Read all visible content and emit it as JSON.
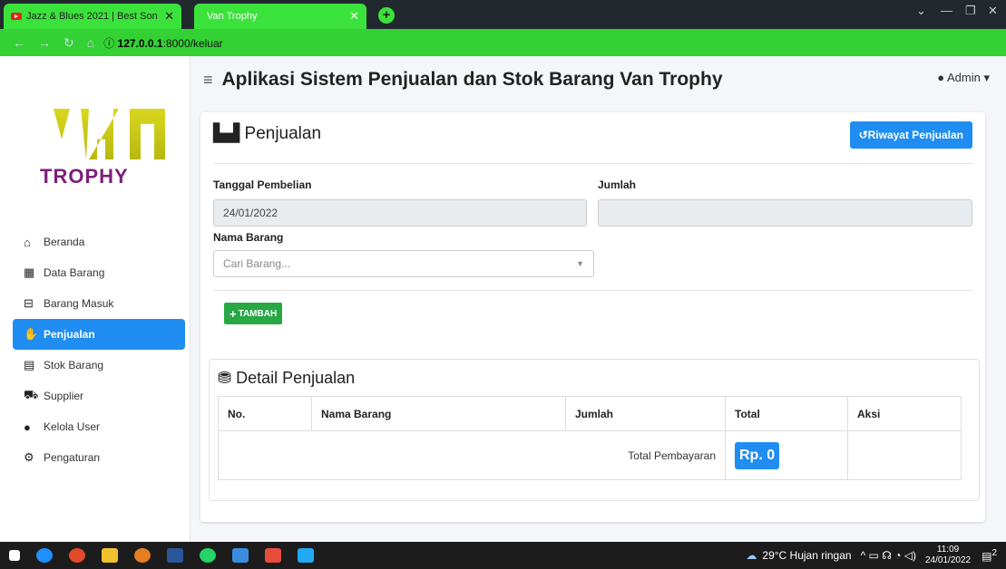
{
  "browser": {
    "tabs": [
      {
        "label": "Jazz & Blues 2021 | Best Son",
        "icon": "youtube-icon"
      },
      {
        "label": "Van Trophy",
        "icon": "favicon"
      }
    ],
    "url_host": "127.0.0.1",
    "url_rest": ":8000/keluar"
  },
  "sidebar": {
    "logo_top": "VAN",
    "logo_bottom": "TROPHY",
    "items": [
      {
        "label": "Beranda",
        "icon": "home-icon"
      },
      {
        "label": "Data Barang",
        "icon": "boxes-icon"
      },
      {
        "label": "Barang Masuk",
        "icon": "inbox-icon"
      },
      {
        "label": "Penjualan",
        "icon": "handshake-icon",
        "active": true
      },
      {
        "label": "Stok Barang",
        "icon": "warehouse-icon"
      },
      {
        "label": "Supplier",
        "icon": "truck-icon"
      },
      {
        "label": "Kelola User",
        "icon": "user-icon"
      },
      {
        "label": "Pengaturan",
        "icon": "cogs-icon"
      }
    ]
  },
  "header": {
    "title": "Aplikasi Sistem Penjualan dan Stok Barang Van Trophy",
    "user": "Admin"
  },
  "card": {
    "title": "Penjualan",
    "history_button": "Riwayat Penjualan",
    "date_label": "Tanggal Pembelian",
    "date_value": "24/01/2022",
    "qty_label": "Jumlah",
    "qty_value": "",
    "item_label": "Nama Barang",
    "item_placeholder": "Cari Barang...",
    "add_button": "TAMBAH"
  },
  "detail": {
    "title": "Detail Penjualan",
    "columns": [
      "No.",
      "Nama Barang",
      "Jumlah",
      "Total",
      "Aksi"
    ],
    "total_label": "Total Pembayaran",
    "total_value": "Rp. 0"
  },
  "taskbar": {
    "weather": "29°C  Hujan ringan",
    "time": "11:09",
    "date": "24/01/2022",
    "notif_count": "2"
  },
  "colors": {
    "primary": "#1f8df2",
    "success": "#28a745",
    "browser_green": "#3be23b"
  }
}
